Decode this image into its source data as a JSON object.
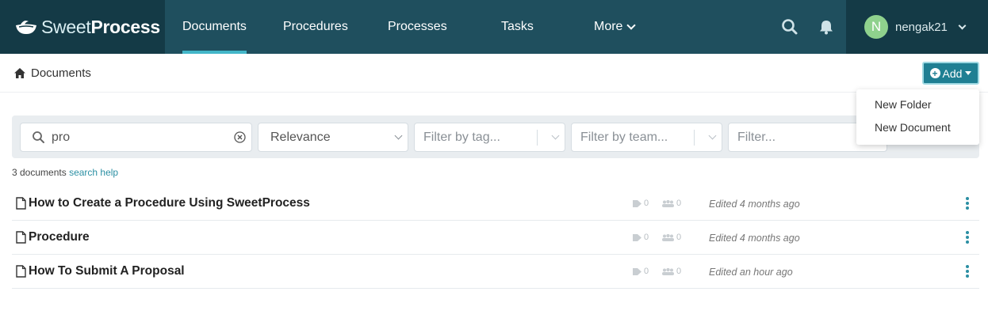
{
  "brand": {
    "name_light": "Sweet",
    "name_bold": "Process"
  },
  "nav": {
    "items": [
      {
        "label": "Documents",
        "active": true
      },
      {
        "label": "Procedures",
        "active": false
      },
      {
        "label": "Processes",
        "active": false
      },
      {
        "label": "Tasks",
        "active": false
      },
      {
        "label": "More",
        "active": false
      }
    ],
    "icons": [
      "search-icon",
      "bell-icon"
    ]
  },
  "user": {
    "initial": "N",
    "name": "nengak21"
  },
  "breadcrumb": {
    "label": "Documents"
  },
  "add_button": {
    "label": "Add"
  },
  "add_menu": {
    "items": [
      "New Folder",
      "New Document"
    ]
  },
  "filters": {
    "search_value": "pro",
    "sort_value": "Relevance",
    "tag_placeholder": "Filter by tag...",
    "team_placeholder": "Filter by team...",
    "generic_placeholder": "Filter..."
  },
  "results": {
    "count_text": "3 documents",
    "help_link": "search help"
  },
  "documents": [
    {
      "title": "How to Create a Procedure Using SweetProcess",
      "tags": "0",
      "teams": "0",
      "edited": "Edited 4 months ago"
    },
    {
      "title": "Procedure",
      "tags": "0",
      "teams": "0",
      "edited": "Edited 4 months ago"
    },
    {
      "title": "How To Submit A Proposal",
      "tags": "0",
      "teams": "0",
      "edited": "Edited an hour ago"
    }
  ],
  "colors": {
    "nav_bg": "#1f4f5e",
    "brand_bg": "#143a46",
    "accent": "#2b8fa3",
    "active_underline": "#43b6c8"
  }
}
